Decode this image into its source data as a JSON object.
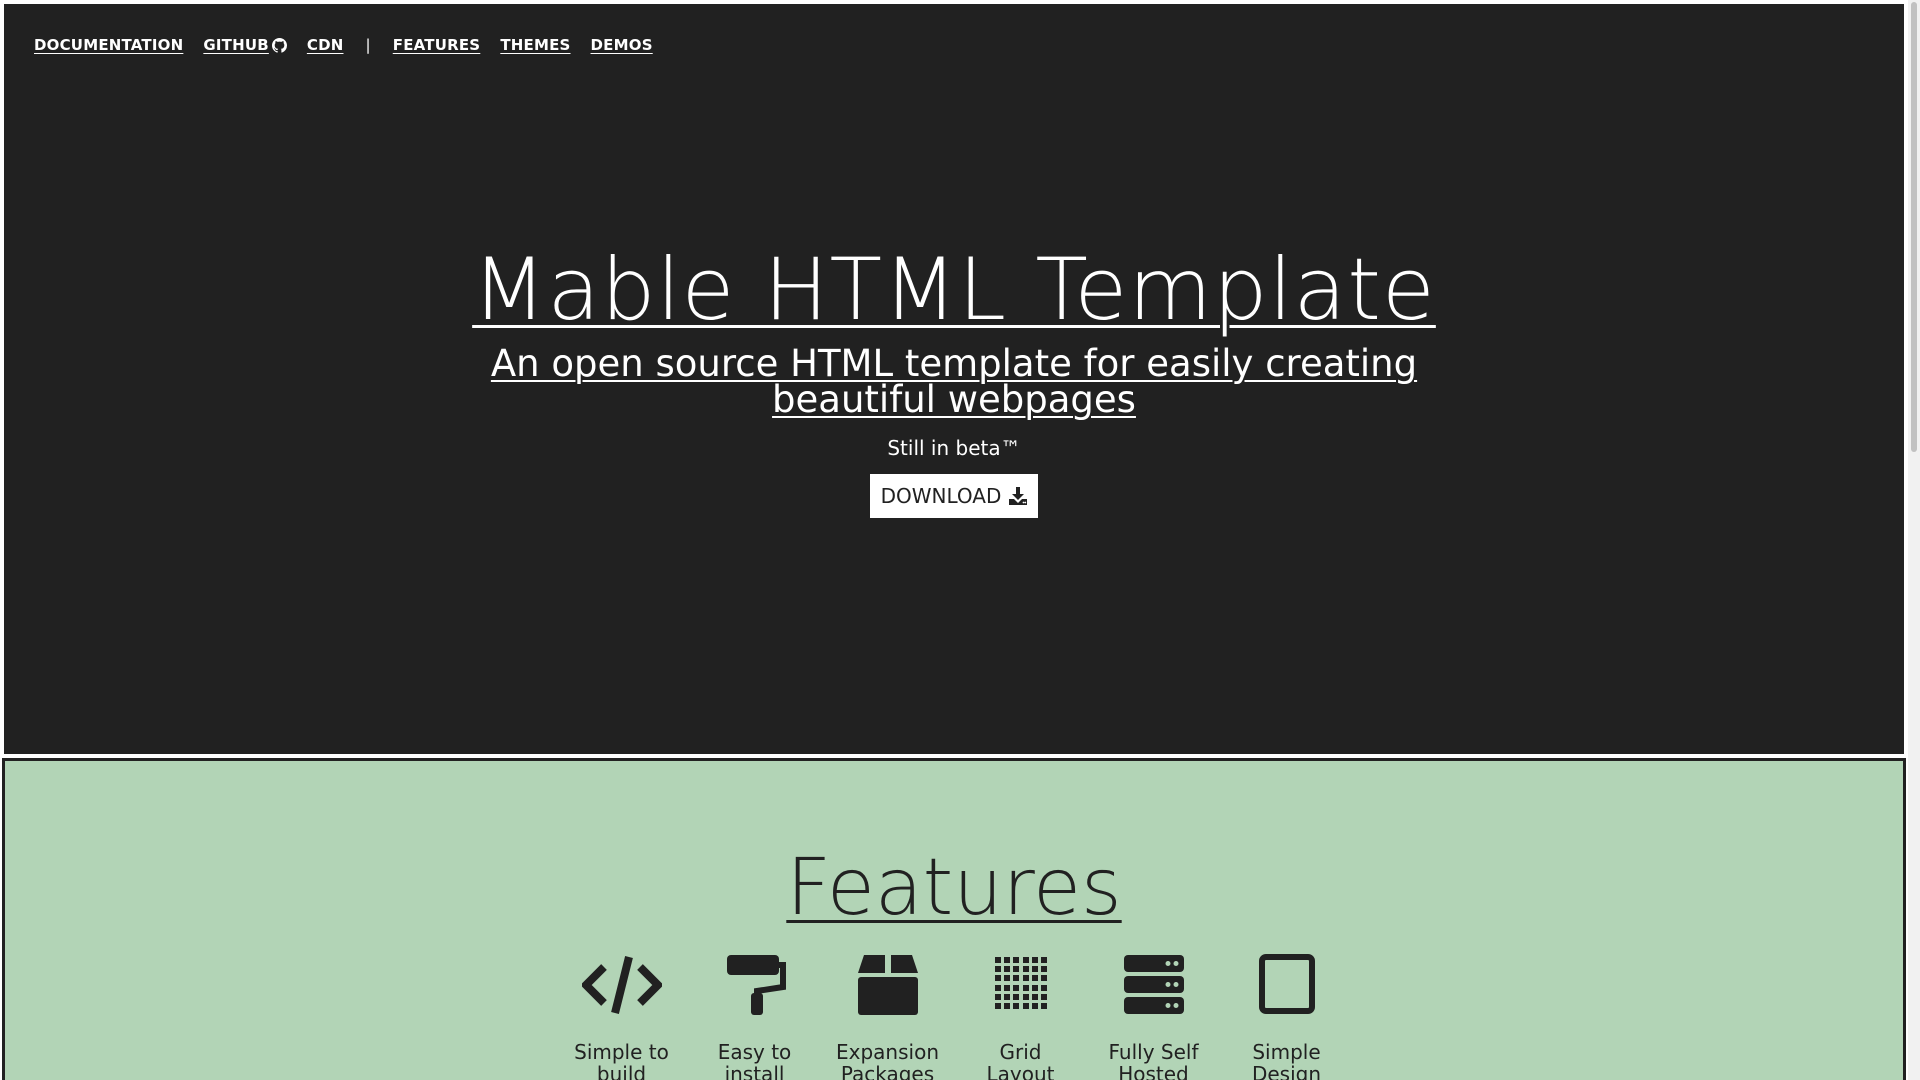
{
  "nav": {
    "documentation": "DOCUMENTATION",
    "github": "GITHUB",
    "cdn": "CDN",
    "separator": "|",
    "features": "FEATURES",
    "themes": "THEMES",
    "demos": "DEMOS"
  },
  "hero": {
    "title": "Mable HTML Template",
    "subtitle": "An open source HTML template for easily creating beautiful webpages",
    "beta": "Still in beta™",
    "download_label": "DOWNLOAD"
  },
  "features": {
    "title": "Features",
    "items": [
      {
        "label": "Simple to build",
        "icon": "code-icon"
      },
      {
        "label": "Easy to install",
        "icon": "paint-roller-icon"
      },
      {
        "label": "Expansion Packages",
        "icon": "box-icon"
      },
      {
        "label": "Grid Layout",
        "icon": "grid-icon"
      },
      {
        "label": "Fully Self Hosted",
        "icon": "server-icon"
      },
      {
        "label": "Simple Design",
        "icon": "square-icon"
      }
    ]
  },
  "colors": {
    "hero_bg": "#212121",
    "features_bg": "#b2d4b6",
    "text_light": "#ffffff",
    "text_dark": "#212121"
  }
}
